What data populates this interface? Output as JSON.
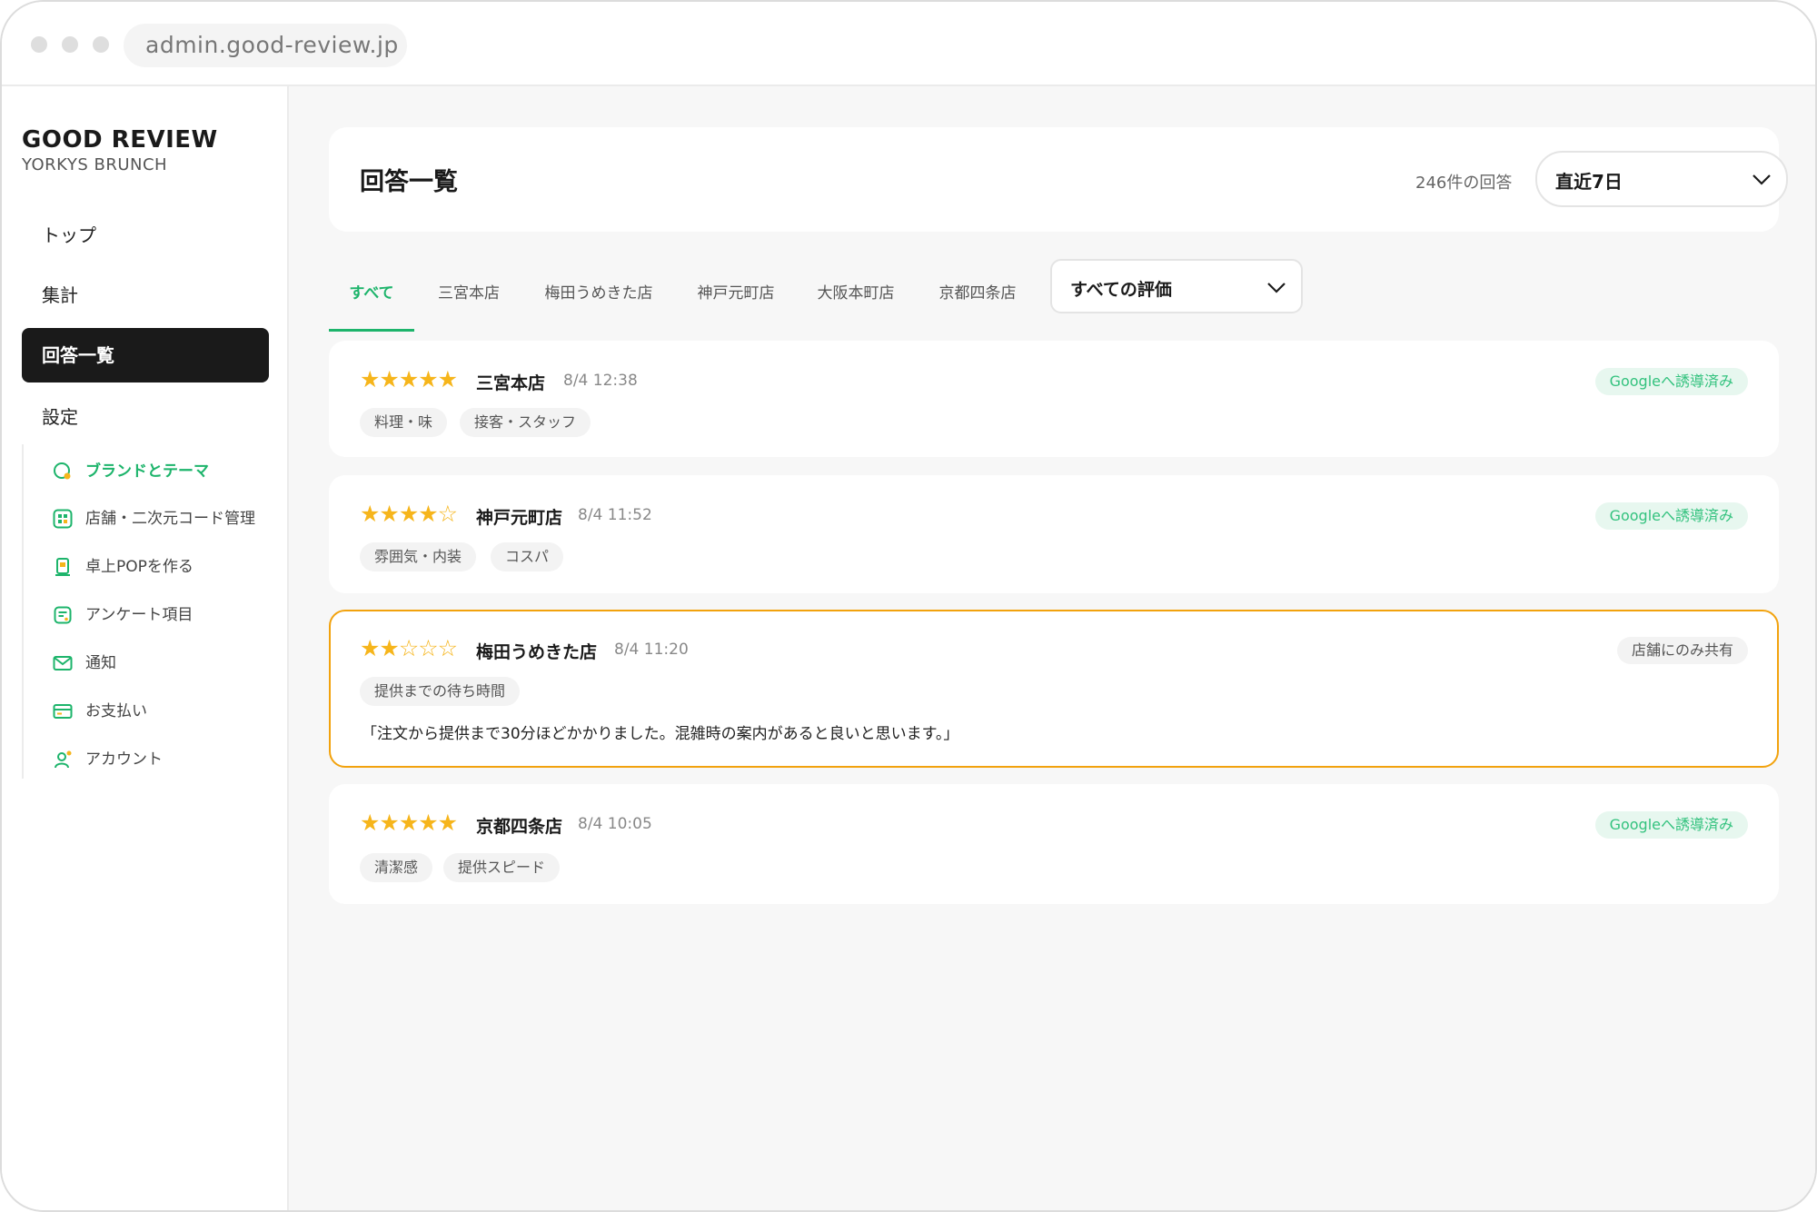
{
  "browser": {
    "url": "admin.good-review.jp"
  },
  "sidebar": {
    "brand_title": "GOOD REVIEW",
    "brand_sub": "YORKYS BRUNCH",
    "nav": [
      {
        "label": "トップ"
      },
      {
        "label": "集計"
      },
      {
        "label": "回答一覧"
      },
      {
        "label": "設定"
      }
    ],
    "settings": [
      {
        "label": "ブランドとテーマ",
        "icon": "palette-icon"
      },
      {
        "label": "店舗・二次元コード管理",
        "icon": "qr-code-icon"
      },
      {
        "label": "卓上POPを作る",
        "icon": "pop-stand-icon"
      },
      {
        "label": "アンケート項目",
        "icon": "survey-icon"
      },
      {
        "label": "通知",
        "icon": "mail-icon"
      },
      {
        "label": "お支払い",
        "icon": "card-icon"
      },
      {
        "label": "アカウント",
        "icon": "user-icon"
      }
    ]
  },
  "header": {
    "title": "回答一覧",
    "count": "246件の回答",
    "period": "直近7日"
  },
  "tabs": [
    {
      "label": "すべて"
    },
    {
      "label": "三宮本店"
    },
    {
      "label": "梅田うめきた店"
    },
    {
      "label": "神戸元町店"
    },
    {
      "label": "大阪本町店"
    },
    {
      "label": "京都四条店"
    }
  ],
  "rating_filter": "すべての評価",
  "reviews": [
    {
      "rating": 5,
      "stars_filled": "★★★★★",
      "stars_empty": "",
      "store": "三宮本店",
      "time": "8/4 12:38",
      "badge": "Googleへ誘導済み",
      "tags": [
        "料理・味",
        "接客・スタッフ"
      ],
      "comment": ""
    },
    {
      "rating": 4,
      "stars_filled": "★★★★",
      "stars_empty": "☆",
      "store": "神戸元町店",
      "time": "8/4 11:52",
      "badge": "Googleへ誘導済み",
      "tags": [
        "雰囲気・内装",
        "コスパ"
      ],
      "comment": ""
    },
    {
      "rating": 2,
      "stars_filled": "★★",
      "stars_empty": "☆☆☆",
      "store": "梅田うめきた店",
      "time": "8/4 11:20",
      "badge": "店舗にのみ共有",
      "tags": [
        "提供までの待ち時間"
      ],
      "comment": "「注文から提供まで30分ほどかかりました。混雑時の案内があると良いと思います。」"
    },
    {
      "rating": 5,
      "stars_filled": "★★★★★",
      "stars_empty": "",
      "store": "京都四条店",
      "time": "8/4 10:05",
      "badge": "Googleへ誘導済み",
      "tags": [
        "清潔感",
        "提供スピード"
      ],
      "comment": ""
    }
  ],
  "colors": {
    "accent": "#1db46b",
    "star": "#f6b51b",
    "highlight": "#f2a20d",
    "active_nav": "#1a1a1a"
  }
}
